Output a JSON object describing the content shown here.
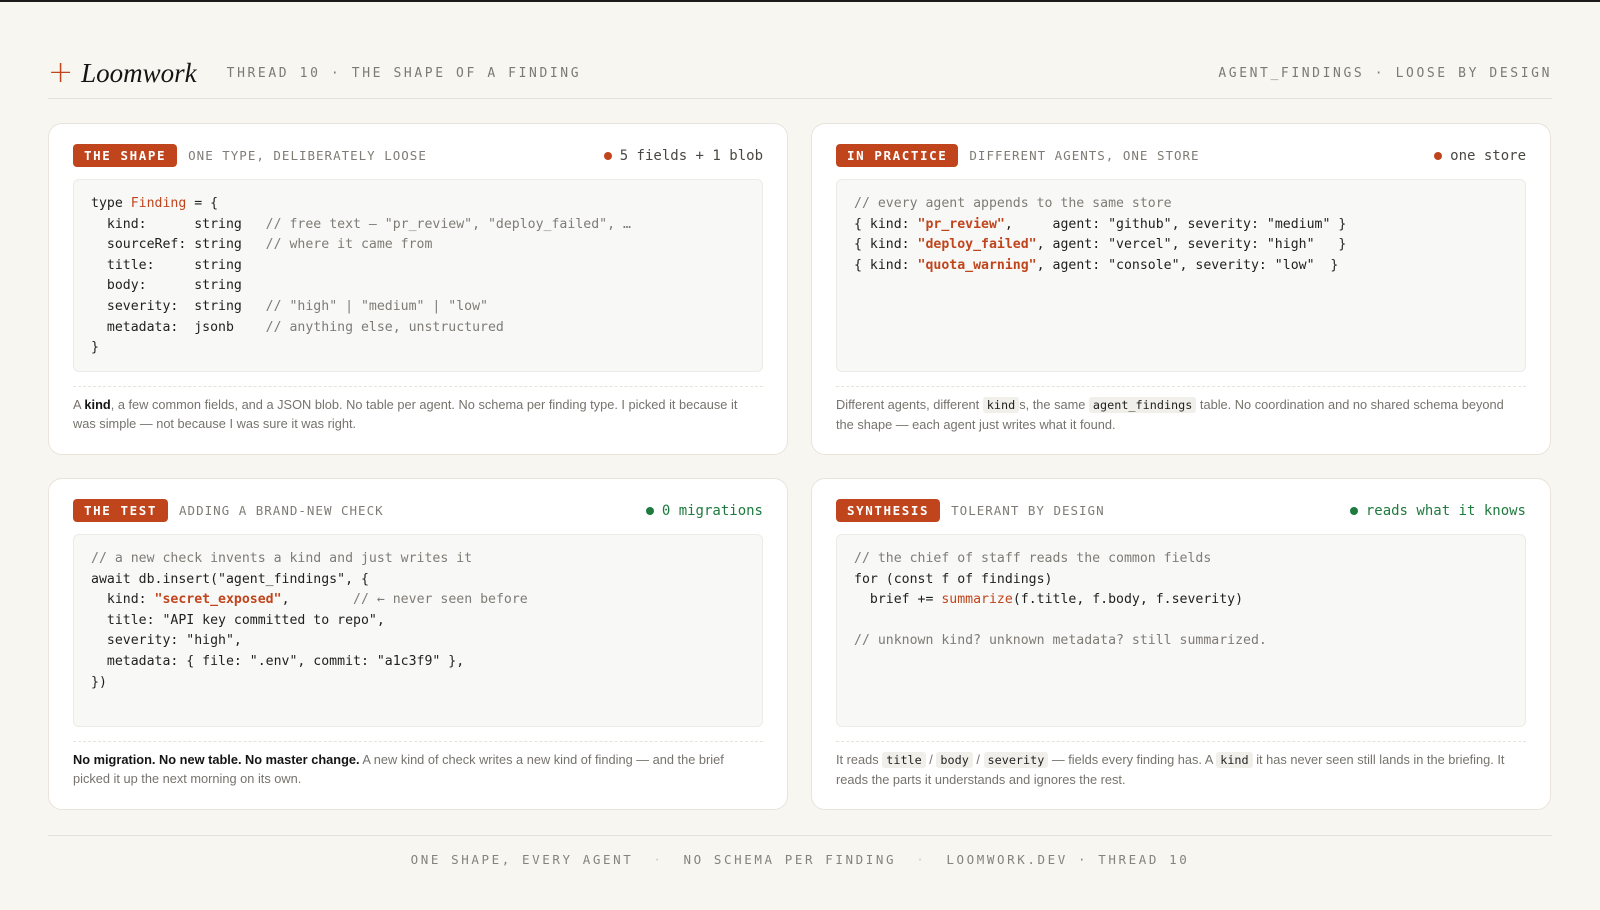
{
  "header": {
    "logo": "Loomwork",
    "subtitle": "THREAD 10 · THE SHAPE OF A FINDING",
    "right": "AGENT_FINDINGS · LOOSE BY DESIGN"
  },
  "cards": [
    {
      "tag": "THE SHAPE",
      "subtitle": "ONE TYPE, DELIBERATELY LOOSE",
      "status": "5 fields + 1 blob",
      "status_color": "#c0451d",
      "code": [
        [
          {
            "t": "type "
          },
          {
            "t": "Finding",
            "c": "hl"
          },
          {
            "t": " = {"
          }
        ],
        [
          {
            "t": "  kind:      string   "
          },
          {
            "t": "// free text — \"pr_review\", \"deploy_failed\", …",
            "c": "cm"
          }
        ],
        [
          {
            "t": "  sourceRef: string   "
          },
          {
            "t": "// where it came from",
            "c": "cm"
          }
        ],
        [
          {
            "t": "  title:     string"
          }
        ],
        [
          {
            "t": "  body:      string"
          }
        ],
        [
          {
            "t": "  severity:  string   "
          },
          {
            "t": "// \"high\" | \"medium\" | \"low\"",
            "c": "cm"
          }
        ],
        [
          {
            "t": "  metadata:  jsonb    "
          },
          {
            "t": "// anything else, unstructured",
            "c": "cm"
          }
        ],
        [
          {
            "t": "}"
          }
        ]
      ],
      "desc": [
        {
          "t": "A "
        },
        {
          "t": "kind",
          "s": "b"
        },
        {
          "t": ", a few common fields, and a JSON blob. No table per agent. No schema per finding type. I picked it because it was simple — not because I was sure it was right."
        }
      ]
    },
    {
      "tag": "IN PRACTICE",
      "subtitle": "DIFFERENT AGENTS, ONE STORE",
      "status": "one store",
      "status_color": "#c0451d",
      "code": [
        [
          {
            "t": "// every agent appends to the same store",
            "c": "cm"
          }
        ],
        [
          {
            "t": "{ kind: "
          },
          {
            "t": "\"pr_review\"",
            "c": "st"
          },
          {
            "t": ",     agent: \"github\", severity: \"medium\" }"
          }
        ],
        [
          {
            "t": "{ kind: "
          },
          {
            "t": "\"deploy_failed\"",
            "c": "st"
          },
          {
            "t": ", agent: \"vercel\", severity: \"high\"   }"
          }
        ],
        [
          {
            "t": "{ kind: "
          },
          {
            "t": "\"quota_warning\"",
            "c": "st"
          },
          {
            "t": ", agent: \"console\", severity: \"low\"  }"
          }
        ]
      ],
      "desc": [
        {
          "t": "Different agents, different "
        },
        {
          "t": "kind",
          "s": "code"
        },
        {
          "t": "s, the same "
        },
        {
          "t": "agent_findings",
          "s": "code"
        },
        {
          "t": " table. No coordination and no shared schema beyond the shape — each agent just writes what it found."
        }
      ]
    },
    {
      "tag": "THE TEST",
      "subtitle": "ADDING A BRAND-NEW CHECK",
      "status": "0 migrations",
      "status_color": "#1e7a3e",
      "code": [
        [
          {
            "t": "// a new check invents a kind and just writes it",
            "c": "cm"
          }
        ],
        [
          {
            "t": "await db.insert(\"agent_findings\", {"
          }
        ],
        [
          {
            "t": "  kind: "
          },
          {
            "t": "\"secret_exposed\"",
            "c": "st"
          },
          {
            "t": ",        "
          },
          {
            "t": "// ← never seen before",
            "c": "cm"
          }
        ],
        [
          {
            "t": "  title: \"API key committed to repo\","
          }
        ],
        [
          {
            "t": "  severity: \"high\","
          }
        ],
        [
          {
            "t": "  metadata: { file: \".env\", commit: \"a1c3f9\" },"
          }
        ],
        [
          {
            "t": "})"
          }
        ]
      ],
      "desc": [
        {
          "t": "No migration. No new table. No master change.",
          "s": "b"
        },
        {
          "t": " A new kind of check writes a new kind of finding — and the brief picked it up the next morning on its own."
        }
      ]
    },
    {
      "tag": "SYNTHESIS",
      "subtitle": "TOLERANT BY DESIGN",
      "status": "reads what it knows",
      "status_color": "#1e7a3e",
      "code": [
        [
          {
            "t": "// the chief of staff reads the common fields",
            "c": "cm"
          }
        ],
        [
          {
            "t": "for (const f of findings)"
          }
        ],
        [
          {
            "t": "  brief += "
          },
          {
            "t": "summarize",
            "c": "hl"
          },
          {
            "t": "(f.title, f.body, f.severity)"
          }
        ],
        [
          {
            "t": ""
          }
        ],
        [
          {
            "t": "// unknown kind? unknown metadata? still summarized.",
            "c": "cm"
          }
        ]
      ],
      "desc": [
        {
          "t": "It reads "
        },
        {
          "t": "title",
          "s": "code"
        },
        {
          "t": " / "
        },
        {
          "t": "body",
          "s": "code"
        },
        {
          "t": " / "
        },
        {
          "t": "severity",
          "s": "code"
        },
        {
          "t": " — fields every finding has. A "
        },
        {
          "t": "kind",
          "s": "code"
        },
        {
          "t": " it has never seen still lands in the briefing. It reads the parts it understands and ignores the rest."
        }
      ]
    }
  ],
  "footer": {
    "items": [
      "ONE SHAPE, EVERY AGENT",
      "NO SCHEMA PER FINDING",
      "LOOMWORK.DEV · THREAD 10"
    ]
  }
}
